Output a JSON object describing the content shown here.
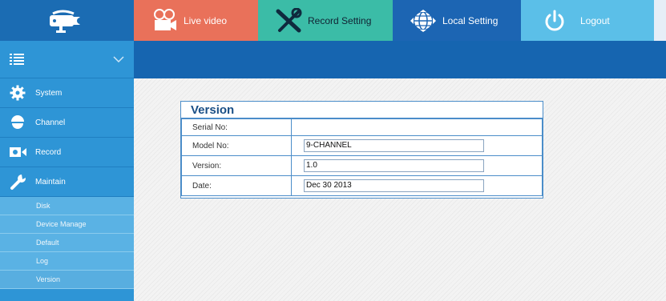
{
  "nav": {
    "live_video": "Live video",
    "record_setting": "Record Setting",
    "local_setting": "Local Setting",
    "logout": "Logout"
  },
  "sidebar": {
    "items": [
      {
        "label": "System",
        "icon": "gear-icon"
      },
      {
        "label": "Channel",
        "icon": "dome-camera-icon"
      },
      {
        "label": "Record",
        "icon": "record-icon"
      },
      {
        "label": "Maintain",
        "icon": "wrench-icon"
      }
    ],
    "sub_items": [
      {
        "label": "Disk"
      },
      {
        "label": "Device Manage"
      },
      {
        "label": "Default"
      },
      {
        "label": "Log"
      },
      {
        "label": "Version",
        "active": true
      }
    ]
  },
  "version_panel": {
    "title": "Version",
    "rows": [
      {
        "label": "Serial No:",
        "value": ""
      },
      {
        "label": "Model No:",
        "value": "9-CHANNEL"
      },
      {
        "label": "Version:",
        "value": "1.0"
      },
      {
        "label": "Date:",
        "value": "Dec 30 2013"
      }
    ]
  },
  "colors": {
    "live_tab": "#e9715a",
    "record_tab": "#3bbca7",
    "local_tab": "#1c65b3",
    "logout_tab": "#5bbfe8",
    "sidebar": "#2e95d6",
    "header_strip": "#1665b0"
  }
}
